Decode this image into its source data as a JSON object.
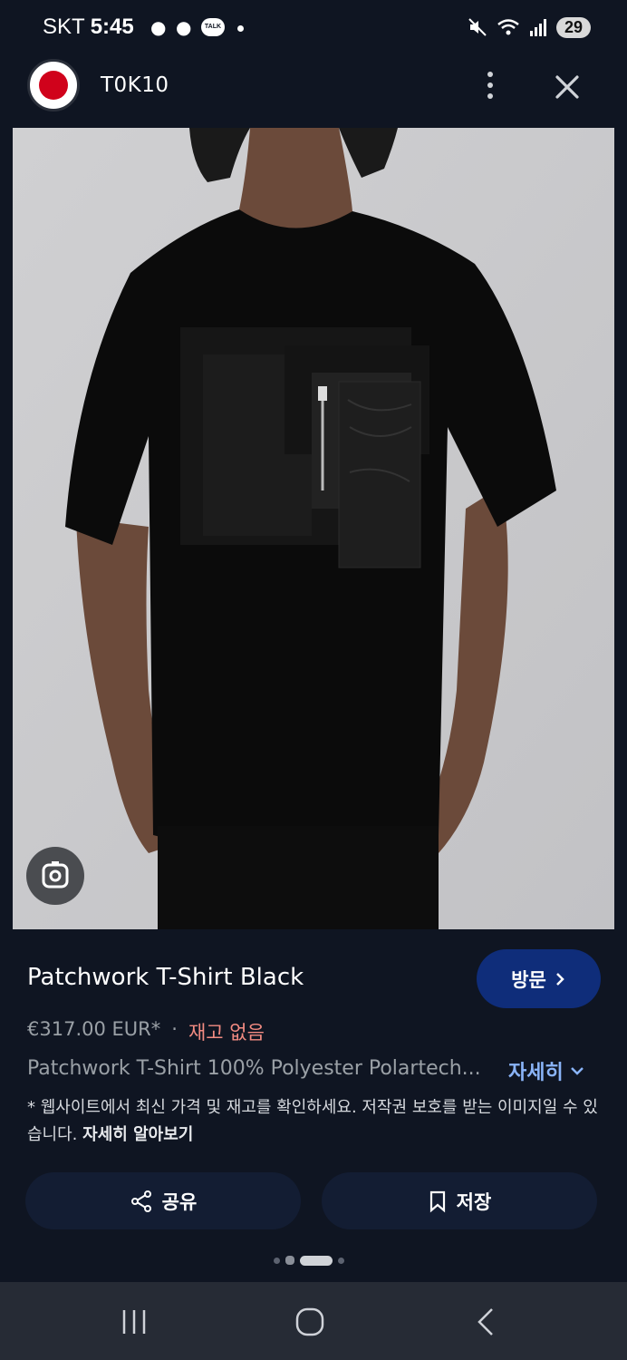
{
  "status_bar": {
    "carrier": "SKT",
    "time": "5:45",
    "talk_badge": "TALK",
    "battery": "29",
    "icons": [
      "notification-icon",
      "notification-icon",
      "talk-icon",
      "mute-icon",
      "wifi-icon",
      "signal-icon"
    ]
  },
  "header": {
    "site_name": "T0K10",
    "more_icon": "more-vert-icon",
    "close_icon": "close-icon"
  },
  "image": {
    "lens_icon": "lens-icon"
  },
  "product": {
    "title": "Patchwork T-Shirt Black",
    "visit_label": "방문",
    "price": "€317.00 EUR*",
    "separator": "·",
    "stock": "재고 없음",
    "description": "Patchwork T-Shirt 100% Polyester Polartech...",
    "more_label": "자세히",
    "notice": "* 웹사이트에서 최신 가격 및 재고를 확인하세요. 저작권 보호를 받는 이미지일 수 있습니다.",
    "notice_link": "자세히 알아보기"
  },
  "actions": {
    "share_label": "공유",
    "save_label": "저장"
  },
  "colors": {
    "background": "#0f1522",
    "visit_button": "#0f2d7a",
    "link": "#8ab4f8",
    "stock": "#f28b82"
  }
}
